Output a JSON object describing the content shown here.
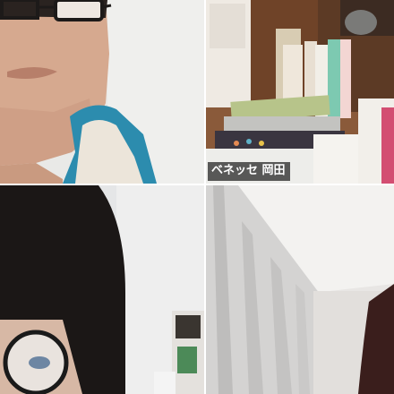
{
  "participants": [
    {
      "id": "p1",
      "name": ""
    },
    {
      "id": "p2",
      "name": "ベネッセ 岡田"
    },
    {
      "id": "p3",
      "name": ""
    },
    {
      "id": "p4",
      "name": ""
    }
  ],
  "colors": {
    "divider": "#ffffff",
    "label_bg": "#1e1e1e",
    "label_text": "#ffffff"
  }
}
